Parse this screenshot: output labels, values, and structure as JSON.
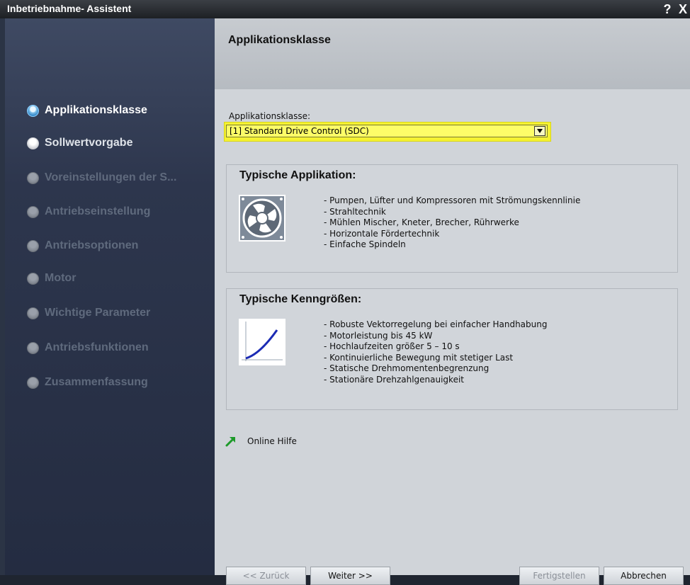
{
  "window": {
    "title": "Inbetriebnahme- Assistent",
    "help_label": "?",
    "close_label": "X"
  },
  "sidebar": {
    "items": [
      {
        "label": "Applikationsklasse",
        "state": "active"
      },
      {
        "label": "Sollwertvorgabe",
        "state": "visited"
      },
      {
        "label": "Voreinstellungen der S...",
        "state": "disabled"
      },
      {
        "label": "Antriebseinstellung",
        "state": "disabled"
      },
      {
        "label": "Antriebsoptionen",
        "state": "disabled"
      },
      {
        "label": "Motor",
        "state": "disabled"
      },
      {
        "label": "Wichtige Parameter",
        "state": "disabled"
      },
      {
        "label": "Antriebsfunktionen",
        "state": "disabled"
      },
      {
        "label": "Zusammenfassung",
        "state": "disabled"
      }
    ]
  },
  "content": {
    "title": "Applikationsklasse",
    "field_label": "Applikationsklasse:",
    "field_value": "[1] Standard Drive Control (SDC)",
    "highlight_color": "#f5f232"
  },
  "typical_application": {
    "title": "Typische Applikation:",
    "icon": "fan-icon",
    "items": [
      "Pumpen, Lüfter und Kompressoren mit Strömungskennlinie",
      "Strahltechnik",
      "Mühlen Mischer, Kneter, Brecher, Rührwerke",
      "Horizontale Fördertechnik",
      "Einfache Spindeln"
    ]
  },
  "typical_parameters": {
    "title": "Typische Kenngrößen:",
    "icon": "curve-graph-icon",
    "items": [
      "Robuste Vektorregelung bei einfacher Handhabung",
      "Motorleistung bis 45 kW",
      "Hochlaufzeiten größer 5 – 10 s",
      "Kontinuierliche Bewegung mit stetiger Last",
      "Statische Drehmomentenbegrenzung",
      "Stationäre Drehzahlgenauigkeit"
    ]
  },
  "online_help": {
    "label": "Online Hilfe",
    "icon": "arrow-up-right-icon"
  },
  "buttons": {
    "back": "<< Zurück",
    "next": "Weiter >>",
    "finish": "Fertigstellen",
    "cancel": "Abbrechen"
  }
}
